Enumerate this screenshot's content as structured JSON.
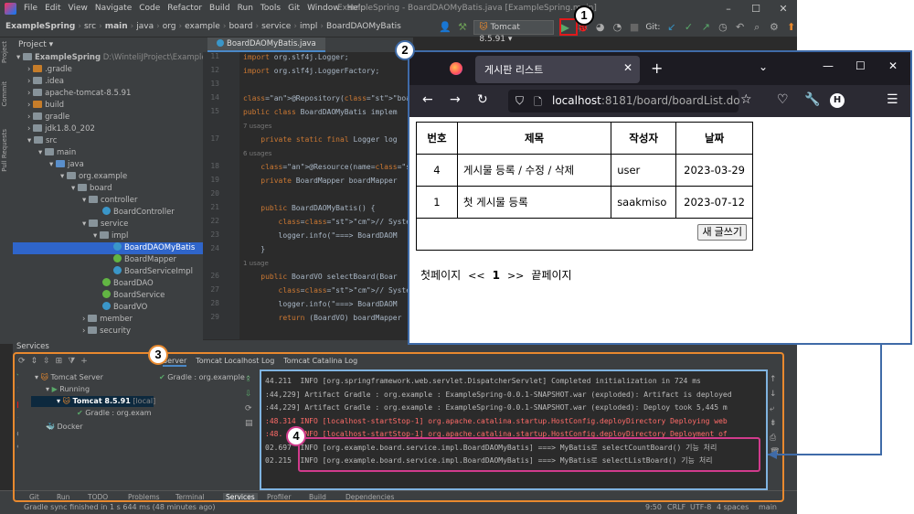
{
  "ide": {
    "menu": [
      "File",
      "Edit",
      "View",
      "Navigate",
      "Code",
      "Refactor",
      "Build",
      "Run",
      "Tools",
      "Git",
      "Window",
      "Help"
    ],
    "window_title": "ExampleSpring - BoardDAOMyBatis.java [ExampleSpring.main]",
    "breadcrumbs": [
      "ExampleSpring",
      "src",
      "main",
      "java",
      "org",
      "example",
      "board",
      "service",
      "impl",
      "BoardDAOMyBatis"
    ],
    "run_config": "Tomcat 8.5.91",
    "git_label": "Git:",
    "editor_tab": "BoardDAOMyBatis.java",
    "project_header": "Project",
    "project_tree": [
      {
        "label": "ExampleSpring",
        "extra": "D:\\WinteliJProject\\ExampleSpring",
        "icon": "folder"
      },
      {
        "label": ".gradle",
        "icon": "folder-orange"
      },
      {
        "label": ".idea",
        "icon": "folder"
      },
      {
        "label": "apache-tomcat-8.5.91",
        "icon": "folder"
      },
      {
        "label": "build",
        "icon": "folder-orange"
      },
      {
        "label": "gradle",
        "icon": "folder"
      },
      {
        "label": "jdk1.8.0_202",
        "icon": "folder"
      },
      {
        "label": "src",
        "icon": "folder"
      },
      {
        "label": "main",
        "icon": "folder"
      },
      {
        "label": "java",
        "icon": "folder-blue"
      },
      {
        "label": "org.example",
        "icon": "folder"
      },
      {
        "label": "board",
        "icon": "folder"
      },
      {
        "label": "controller",
        "icon": "folder"
      },
      {
        "label": "BoardController",
        "icon": "class"
      },
      {
        "label": "service",
        "icon": "folder"
      },
      {
        "label": "impl",
        "icon": "folder"
      },
      {
        "label": "BoardDAOMyBatis",
        "icon": "class"
      },
      {
        "label": "BoardMapper",
        "icon": "interface"
      },
      {
        "label": "BoardServiceImpl",
        "icon": "class"
      },
      {
        "label": "BoardDAO",
        "icon": "interface"
      },
      {
        "label": "BoardService",
        "icon": "interface"
      },
      {
        "label": "BoardVO",
        "icon": "class"
      },
      {
        "label": "member",
        "icon": "folder"
      },
      {
        "label": "security",
        "icon": "folder"
      }
    ],
    "left_tools": [
      "Project",
      "Commit",
      "Pull Requests"
    ],
    "code_lines": [
      {
        "n": "11",
        "t": "import org.slf4j.Logger;"
      },
      {
        "n": "12",
        "t": "import org.slf4j.LoggerFactory;"
      },
      {
        "n": "13",
        "t": ""
      },
      {
        "n": "14",
        "t": "@Repository(\"boardDaoMyBatis\")"
      },
      {
        "n": "15",
        "t": "public class BoardDAOMyBatis implem"
      },
      {
        "n": "",
        "t": "7 usages"
      },
      {
        "n": "17",
        "t": "    private static final Logger log"
      },
      {
        "n": "",
        "t": "6 usages"
      },
      {
        "n": "18",
        "t": "    @Resource(name=\"boardMapper\")"
      },
      {
        "n": "19",
        "t": "    private BoardMapper boardMapper"
      },
      {
        "n": "20",
        "t": ""
      },
      {
        "n": "21",
        "t": "    public BoardDAOMyBatis() {"
      },
      {
        "n": "22",
        "t": "        // System.out.println(\"===>"
      },
      {
        "n": "23",
        "t": "        logger.info(\"===> BoardDAOM"
      },
      {
        "n": "24",
        "t": "    }"
      },
      {
        "n": "",
        "t": "1 usage"
      },
      {
        "n": "26",
        "t": "    public BoardVO selectBoard(Boar"
      },
      {
        "n": "27",
        "t": "        // System.out.println(\"===>"
      },
      {
        "n": "28",
        "t": "        logger.info(\"===> BoardDAOM"
      },
      {
        "n": "29",
        "t": "        return (BoardVO) boardMapper"
      }
    ],
    "services_header": "Services",
    "services_tree": [
      {
        "label": "Tomcat Server"
      },
      {
        "label": "Running"
      },
      {
        "label": "Tomcat 8.5.91",
        "extra": "[local]"
      },
      {
        "label": "Gradle : org.exam"
      },
      {
        "label": "Docker"
      }
    ],
    "deployment_label": "Gradle : org.example :",
    "log_tabs": [
      "Server",
      "Tomcat Localhost Log",
      "Tomcat Catalina Log"
    ],
    "console_lines": [
      {
        "text": "44.211  INFO [org.springframework.web.servlet.DispatcherServlet] Completed initialization in 724 ms",
        "level": "info"
      },
      {
        "text": ":44,229] Artifact Gradle : org.example : ExampleSpring-0.0.1-SNAPSHOT.war (exploded): Artifact is deployed",
        "level": "info"
      },
      {
        "text": ":44,229] Artifact Gradle : org.example : ExampleSpring-0.0.1-SNAPSHOT.war (exploded): Deploy took 5,445 m",
        "level": "info"
      },
      {
        "text": ":48.314 INFO [localhost-startStop-1] org.apache.catalina.startup.HostConfig.deployDirectory Deploying web",
        "level": "red"
      },
      {
        "text": ":48.    INFO [localhost-startStop-1] org.apache.catalina.startup.HostConfig.deployDirectory Deployment of",
        "level": "red"
      },
      {
        "text": "02.697  INFO [org.example.board.service.impl.BoardDAOMyBatis] ===> MyBatis로 selectCountBoard() 기능 처리",
        "level": "info"
      },
      {
        "text": "02.215  INFO [org.example.board.service.impl.BoardDAOMyBatis] ===> MyBatis로 selectListBoard() 기능 처리",
        "level": "info"
      }
    ],
    "bottom_tabs": [
      "Git",
      "Run",
      "TODO",
      "Problems",
      "Terminal",
      "Services",
      "Profiler",
      "Build",
      "Dependencies"
    ],
    "status_left": "Gradle sync finished in 1 s 644 ms (48 minutes ago)",
    "status_right": [
      "9:50",
      "CRLF",
      "UTF-8",
      "4 spaces",
      "main"
    ]
  },
  "browser": {
    "tab_title": "게시판 리스트",
    "url_host": "localhost",
    "url_rest": ":8181/board/boardList.do",
    "profile_letter": "H",
    "table": {
      "headers": [
        "번호",
        "제목",
        "작성자",
        "날짜"
      ],
      "rows": [
        [
          "4",
          "게시물 등록 / 수정 / 삭제",
          "user",
          "2023-03-29"
        ],
        [
          "1",
          "첫 게시물 등록",
          "saakmiso",
          "2023-07-12"
        ]
      ]
    },
    "write_button": "새 글쓰기",
    "pager": {
      "first": "첫페이지",
      "prev": "<<",
      "current": "1",
      "next": ">>",
      "last": "끝페이지"
    }
  },
  "annotations": {
    "badges": [
      "1",
      "2",
      "3",
      "4"
    ],
    "colors": {
      "red": "#e0191b",
      "blue": "#3f6ba8",
      "orange": "#e8892e",
      "pink": "#d13b8c",
      "lightblue": "#7fb3e0"
    }
  }
}
